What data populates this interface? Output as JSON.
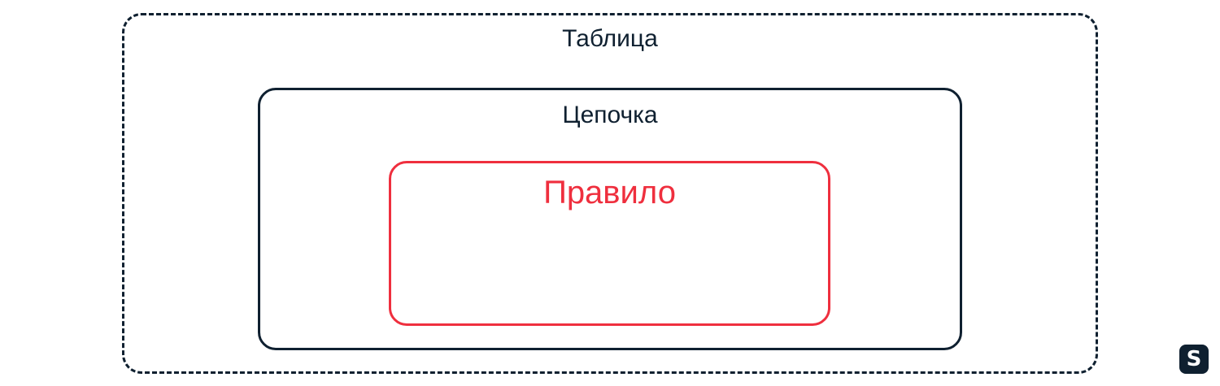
{
  "colors": {
    "dark": "#0f2030",
    "accent": "#ef2f3e"
  },
  "diagram": {
    "table": {
      "label": "Таблица"
    },
    "chain": {
      "label": "Цепочка"
    },
    "rule": {
      "label": "Правило"
    }
  },
  "logo": {
    "icon": "s-logo-icon",
    "text": "S"
  }
}
